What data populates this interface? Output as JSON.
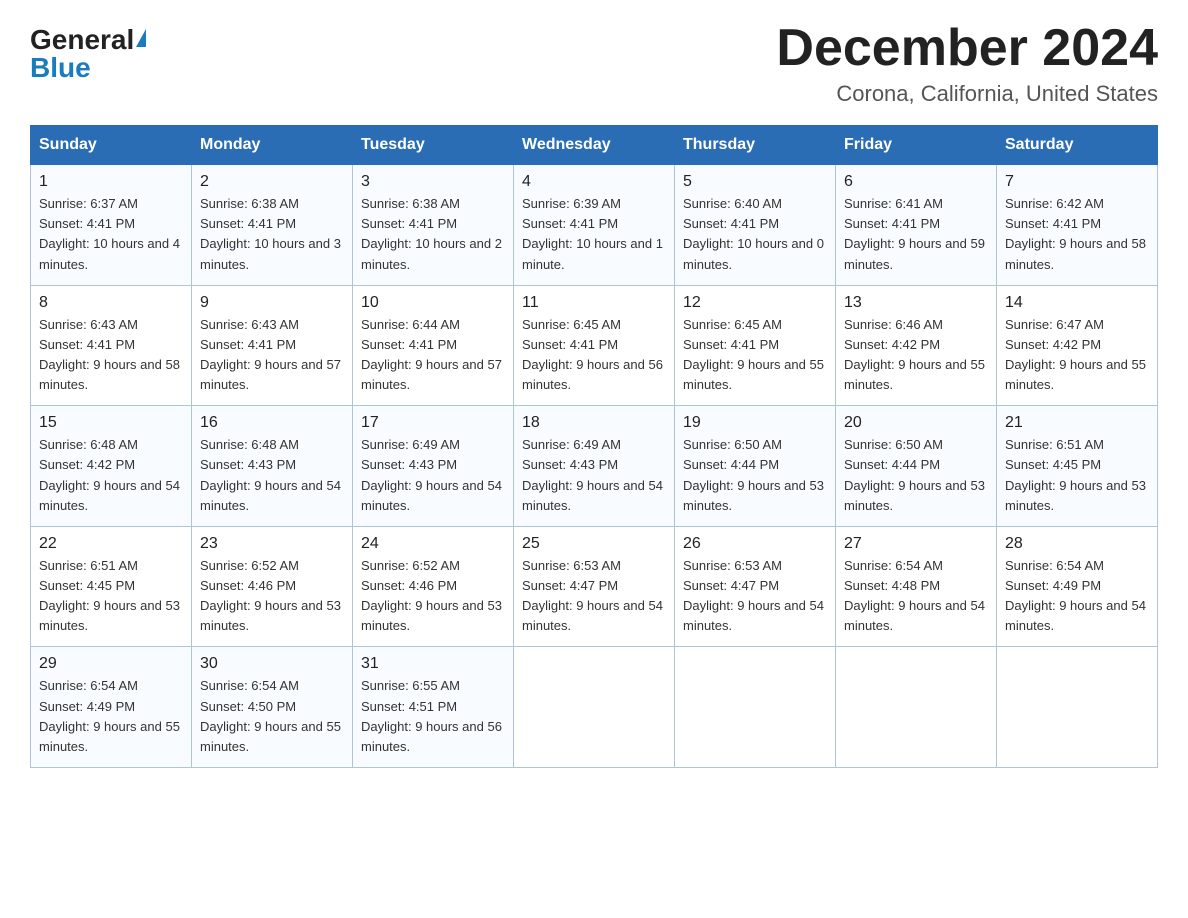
{
  "logo": {
    "general": "General",
    "blue": "Blue"
  },
  "title": "December 2024",
  "location": "Corona, California, United States",
  "weekdays": [
    "Sunday",
    "Monday",
    "Tuesday",
    "Wednesday",
    "Thursday",
    "Friday",
    "Saturday"
  ],
  "weeks": [
    [
      {
        "day": "1",
        "sunrise": "6:37 AM",
        "sunset": "4:41 PM",
        "daylight": "10 hours and 4 minutes."
      },
      {
        "day": "2",
        "sunrise": "6:38 AM",
        "sunset": "4:41 PM",
        "daylight": "10 hours and 3 minutes."
      },
      {
        "day": "3",
        "sunrise": "6:38 AM",
        "sunset": "4:41 PM",
        "daylight": "10 hours and 2 minutes."
      },
      {
        "day": "4",
        "sunrise": "6:39 AM",
        "sunset": "4:41 PM",
        "daylight": "10 hours and 1 minute."
      },
      {
        "day": "5",
        "sunrise": "6:40 AM",
        "sunset": "4:41 PM",
        "daylight": "10 hours and 0 minutes."
      },
      {
        "day": "6",
        "sunrise": "6:41 AM",
        "sunset": "4:41 PM",
        "daylight": "9 hours and 59 minutes."
      },
      {
        "day": "7",
        "sunrise": "6:42 AM",
        "sunset": "4:41 PM",
        "daylight": "9 hours and 58 minutes."
      }
    ],
    [
      {
        "day": "8",
        "sunrise": "6:43 AM",
        "sunset": "4:41 PM",
        "daylight": "9 hours and 58 minutes."
      },
      {
        "day": "9",
        "sunrise": "6:43 AM",
        "sunset": "4:41 PM",
        "daylight": "9 hours and 57 minutes."
      },
      {
        "day": "10",
        "sunrise": "6:44 AM",
        "sunset": "4:41 PM",
        "daylight": "9 hours and 57 minutes."
      },
      {
        "day": "11",
        "sunrise": "6:45 AM",
        "sunset": "4:41 PM",
        "daylight": "9 hours and 56 minutes."
      },
      {
        "day": "12",
        "sunrise": "6:45 AM",
        "sunset": "4:41 PM",
        "daylight": "9 hours and 55 minutes."
      },
      {
        "day": "13",
        "sunrise": "6:46 AM",
        "sunset": "4:42 PM",
        "daylight": "9 hours and 55 minutes."
      },
      {
        "day": "14",
        "sunrise": "6:47 AM",
        "sunset": "4:42 PM",
        "daylight": "9 hours and 55 minutes."
      }
    ],
    [
      {
        "day": "15",
        "sunrise": "6:48 AM",
        "sunset": "4:42 PM",
        "daylight": "9 hours and 54 minutes."
      },
      {
        "day": "16",
        "sunrise": "6:48 AM",
        "sunset": "4:43 PM",
        "daylight": "9 hours and 54 minutes."
      },
      {
        "day": "17",
        "sunrise": "6:49 AM",
        "sunset": "4:43 PM",
        "daylight": "9 hours and 54 minutes."
      },
      {
        "day": "18",
        "sunrise": "6:49 AM",
        "sunset": "4:43 PM",
        "daylight": "9 hours and 54 minutes."
      },
      {
        "day": "19",
        "sunrise": "6:50 AM",
        "sunset": "4:44 PM",
        "daylight": "9 hours and 53 minutes."
      },
      {
        "day": "20",
        "sunrise": "6:50 AM",
        "sunset": "4:44 PM",
        "daylight": "9 hours and 53 minutes."
      },
      {
        "day": "21",
        "sunrise": "6:51 AM",
        "sunset": "4:45 PM",
        "daylight": "9 hours and 53 minutes."
      }
    ],
    [
      {
        "day": "22",
        "sunrise": "6:51 AM",
        "sunset": "4:45 PM",
        "daylight": "9 hours and 53 minutes."
      },
      {
        "day": "23",
        "sunrise": "6:52 AM",
        "sunset": "4:46 PM",
        "daylight": "9 hours and 53 minutes."
      },
      {
        "day": "24",
        "sunrise": "6:52 AM",
        "sunset": "4:46 PM",
        "daylight": "9 hours and 53 minutes."
      },
      {
        "day": "25",
        "sunrise": "6:53 AM",
        "sunset": "4:47 PM",
        "daylight": "9 hours and 54 minutes."
      },
      {
        "day": "26",
        "sunrise": "6:53 AM",
        "sunset": "4:47 PM",
        "daylight": "9 hours and 54 minutes."
      },
      {
        "day": "27",
        "sunrise": "6:54 AM",
        "sunset": "4:48 PM",
        "daylight": "9 hours and 54 minutes."
      },
      {
        "day": "28",
        "sunrise": "6:54 AM",
        "sunset": "4:49 PM",
        "daylight": "9 hours and 54 minutes."
      }
    ],
    [
      {
        "day": "29",
        "sunrise": "6:54 AM",
        "sunset": "4:49 PM",
        "daylight": "9 hours and 55 minutes."
      },
      {
        "day": "30",
        "sunrise": "6:54 AM",
        "sunset": "4:50 PM",
        "daylight": "9 hours and 55 minutes."
      },
      {
        "day": "31",
        "sunrise": "6:55 AM",
        "sunset": "4:51 PM",
        "daylight": "9 hours and 56 minutes."
      },
      null,
      null,
      null,
      null
    ]
  ]
}
